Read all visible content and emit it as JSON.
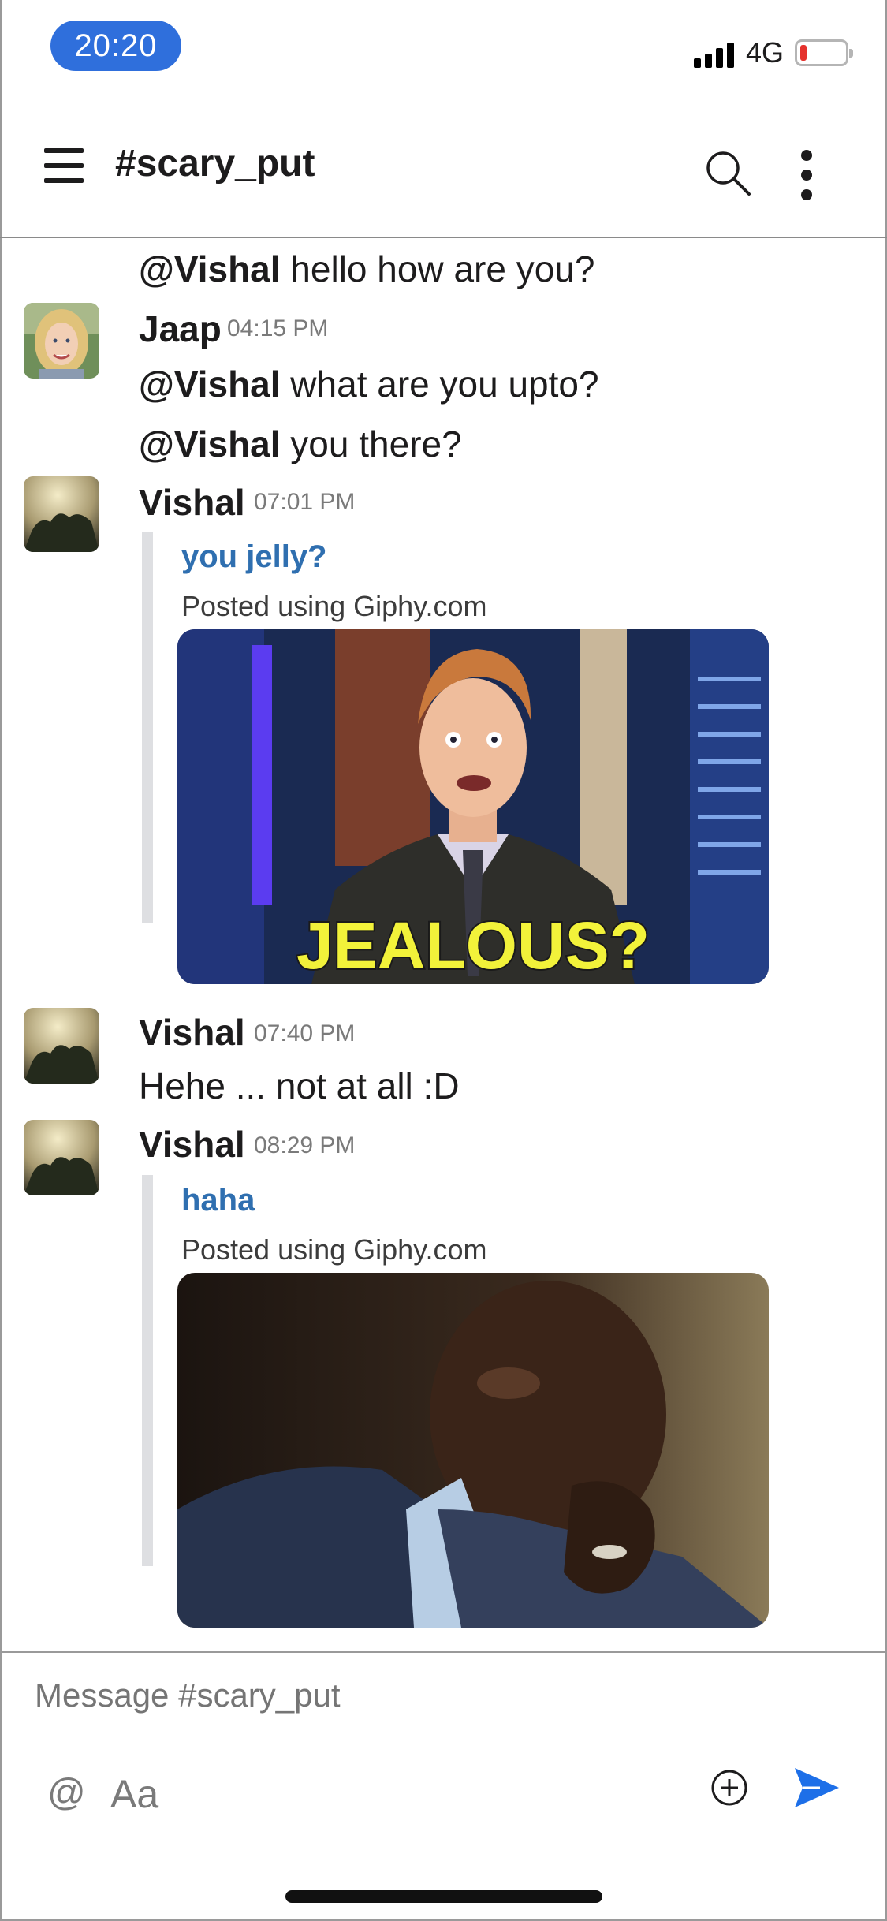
{
  "status_bar": {
    "time": "20:20",
    "network": "4G",
    "battery_color": "#e5322d"
  },
  "header": {
    "channel": "#scary_put"
  },
  "messages": [
    {
      "mention": "@Vishal",
      "text": " hello how are you?"
    },
    {
      "author": "Jaap",
      "time": "04:15 PM",
      "lines": [
        {
          "mention": "@Vishal",
          "text": " what are you upto?"
        },
        {
          "mention": "@Vishal",
          "text": " you there?"
        }
      ]
    },
    {
      "author": "Vishal",
      "time": "07:01 PM",
      "attachment": {
        "title": "you jelly?",
        "subtitle": "Posted using Giphy.com",
        "gif_caption": "JEALOUS?"
      }
    },
    {
      "author": "Vishal",
      "time": "07:40 PM",
      "text": "Hehe ... not at all :D"
    },
    {
      "author": "Vishal",
      "time": "08:29 PM",
      "attachment": {
        "title": "haha",
        "subtitle": "Posted using Giphy.com"
      }
    }
  ],
  "composer": {
    "placeholder": "Message #scary_put",
    "at_label": "@",
    "format_label": "Aa"
  },
  "colors": {
    "accent": "#2f6fdc",
    "link": "#2f6fb0",
    "send": "#1d6fe8"
  }
}
